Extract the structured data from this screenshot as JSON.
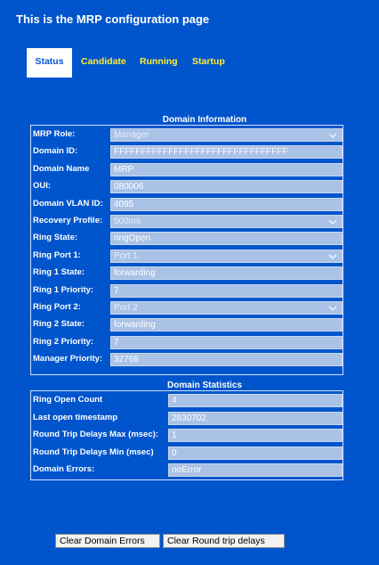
{
  "page": {
    "title": "This is the MRP configuration page"
  },
  "tabs": [
    {
      "label": "Status",
      "active": true
    },
    {
      "label": "Candidate",
      "active": false
    },
    {
      "label": "Running",
      "active": false
    },
    {
      "label": "Startup",
      "active": false
    }
  ],
  "domain_info": {
    "heading": "Domain Information",
    "rows": [
      {
        "label": "MRP Role:",
        "value": "Manager",
        "type": "select"
      },
      {
        "label": "Domain ID:",
        "value": "FFFFFFFFFFFFFFFFFFFFFFFFFFFFFFFF",
        "type": "text"
      },
      {
        "label": "Domain Name",
        "value": "MRP",
        "type": "text"
      },
      {
        "label": "OUI:",
        "value": "080006",
        "type": "text"
      },
      {
        "label": "Domain VLAN ID:",
        "value": "4095",
        "type": "text"
      },
      {
        "label": "Recovery Profile:",
        "value": "500ms",
        "type": "select"
      },
      {
        "label": "Ring State:",
        "value": "ringOpen",
        "type": "text"
      },
      {
        "label": "Ring Port 1:",
        "value": "Port 1",
        "type": "select"
      },
      {
        "label": "Ring 1 State:",
        "value": "forwarding",
        "type": "text"
      },
      {
        "label": "Ring 1 Priority:",
        "value": "7",
        "type": "text"
      },
      {
        "label": "Ring Port 2:",
        "value": "Port 2",
        "type": "select"
      },
      {
        "label": "Ring 2 State:",
        "value": "forwarding",
        "type": "text"
      },
      {
        "label": "Ring 2 Priority:",
        "value": "7",
        "type": "text"
      },
      {
        "label": "Manager Priority:",
        "value": "32768",
        "type": "text"
      }
    ]
  },
  "domain_stats": {
    "heading": "Domain Statistics",
    "rows": [
      {
        "label": "Ring Open Count",
        "value": "4"
      },
      {
        "label": "Last open timestamp",
        "value": "2630702"
      },
      {
        "label": "Round Trip Delays Max (msec):",
        "value": "1"
      },
      {
        "label": "Round Trip Delays Min (msec)",
        "value": "0"
      },
      {
        "label": "Domain Errors:",
        "value": "noError"
      }
    ]
  },
  "buttons": {
    "clear_errors": "Clear Domain Errors",
    "clear_delays": "Clear Round trip delays"
  }
}
